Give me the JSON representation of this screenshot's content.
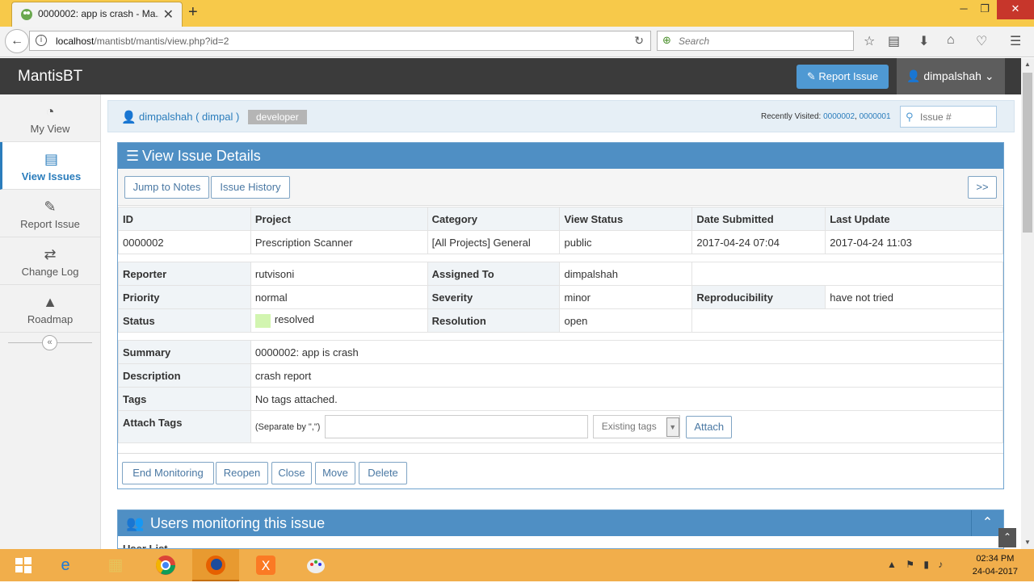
{
  "browser": {
    "tab_title": "0000002: app is crash - Ma...",
    "url_host": "localhost",
    "url_path": "/mantisbt/mantis/view.php?id=2",
    "search_placeholder": "Search"
  },
  "app": {
    "brand": "MantisBT",
    "report_issue": "Report Issue",
    "user_menu": "dimpalshah"
  },
  "sidebar": {
    "items": [
      {
        "label": "My View",
        "icon": "dashboard-icon"
      },
      {
        "label": "View Issues",
        "icon": "list-icon"
      },
      {
        "label": "Report Issue",
        "icon": "edit-icon"
      },
      {
        "label": "Change Log",
        "icon": "retweet-icon"
      },
      {
        "label": "Roadmap",
        "icon": "road-icon"
      }
    ]
  },
  "infobar": {
    "user": "dimpalshah ( dimpal )",
    "role": "developer",
    "recent_label": "Recently Visited:",
    "recent_1": "0000002",
    "recent_2": "0000001",
    "issue_placeholder": "Issue #"
  },
  "details": {
    "title": "View Issue Details",
    "jump_to_notes": "Jump to Notes",
    "issue_history": "Issue History",
    "next": ">>",
    "headers": [
      "ID",
      "Project",
      "Category",
      "View Status",
      "Date Submitted",
      "Last Update"
    ],
    "values": [
      "0000002",
      "Prescription Scanner",
      "[All Projects] General",
      "public",
      "2017-04-24 07:04",
      "2017-04-24 11:03"
    ],
    "reporter_label": "Reporter",
    "reporter": "rutvisoni",
    "assigned_label": "Assigned To",
    "assigned": "dimpalshah",
    "priority_label": "Priority",
    "priority": "normal",
    "severity_label": "Severity",
    "severity": "minor",
    "repro_label": "Reproducibility",
    "repro": "have not tried",
    "status_label": "Status",
    "status": "resolved",
    "status_color": "#d2f5b0",
    "resolution_label": "Resolution",
    "resolution": "open",
    "summary_label": "Summary",
    "summary": "0000002: app is crash",
    "description_label": "Description",
    "description": "crash report",
    "tags_label": "Tags",
    "tags": "No tags attached.",
    "attach_tags_label": "Attach Tags",
    "separator_hint": "(Separate by \",\")",
    "existing_tags": "Existing tags",
    "attach": "Attach"
  },
  "actions": [
    "End Monitoring",
    "Reopen",
    "Close",
    "Move",
    "Delete"
  ],
  "monitoring": {
    "title": "Users monitoring this issue",
    "user_list_label": "User List"
  },
  "taskbar": {
    "time": "02:34 PM",
    "date": "24-04-2017"
  },
  "colors": {
    "accent": "#4f8fc4",
    "link": "#2b7dbc",
    "appbar": "#3b3b3b",
    "taskbar": "#f1ae4b"
  }
}
